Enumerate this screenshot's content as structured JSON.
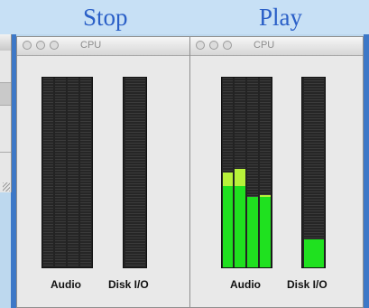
{
  "header": {
    "stop_label": "Stop",
    "play_label": "Play"
  },
  "windows": [
    {
      "state": "stop",
      "title": "CPU",
      "audio_label": "Audio",
      "disk_label": "Disk I/O",
      "audio_levels": [
        0,
        0,
        0,
        0
      ],
      "audio_peaks": [
        null,
        null,
        null,
        null
      ],
      "disk_level": 0
    },
    {
      "state": "play",
      "title": "CPU",
      "audio_label": "Audio",
      "disk_label": "Disk I/O",
      "audio_levels": [
        0.43,
        0.43,
        0.37,
        0.37
      ],
      "audio_peaks": [
        0.5,
        0.52,
        0.36,
        0.38
      ],
      "disk_level": 0.15
    }
  ],
  "colors": {
    "meter_fill": "#1fe11f",
    "peak": "#b7f23a",
    "header_text": "#2a5fc7",
    "frame": "#3d78c7"
  }
}
